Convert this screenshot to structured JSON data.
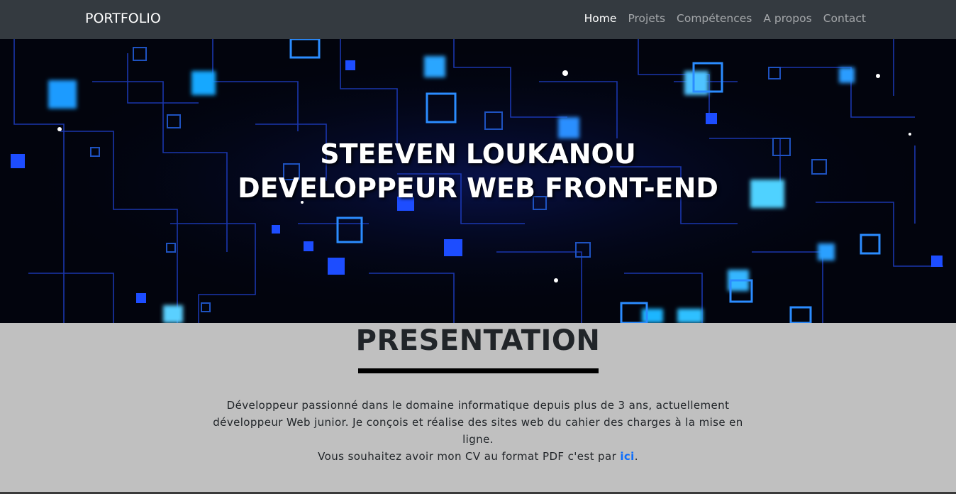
{
  "navbar": {
    "brand": "PORTFOLIO",
    "links": [
      {
        "label": "Home",
        "active": true
      },
      {
        "label": "Projets",
        "active": false
      },
      {
        "label": "Compétences",
        "active": false
      },
      {
        "label": "A propos",
        "active": false
      },
      {
        "label": "Contact",
        "active": false
      }
    ]
  },
  "hero": {
    "line1": "STEEVEN LOUKANOU",
    "line2": "DEVELOPPEUR WEB FRONT-END",
    "background": "circuit-board-image"
  },
  "presentation": {
    "title": "PRESENTATION",
    "paragraph": "Développeur passionné dans le domaine informatique depuis plus de 3 ans, actuellement développeur Web junior. Je conçois et réalise des sites web du cahier des charges à la mise en ligne.",
    "cv_prefix": "Vous souhaitez avoir mon CV au format PDF c'est par ",
    "cv_link": "ici",
    "cv_suffix": "."
  },
  "colors": {
    "navbar_bg": "#343a40",
    "section_bg": "#c0c0c0",
    "link": "#0d6efd"
  }
}
